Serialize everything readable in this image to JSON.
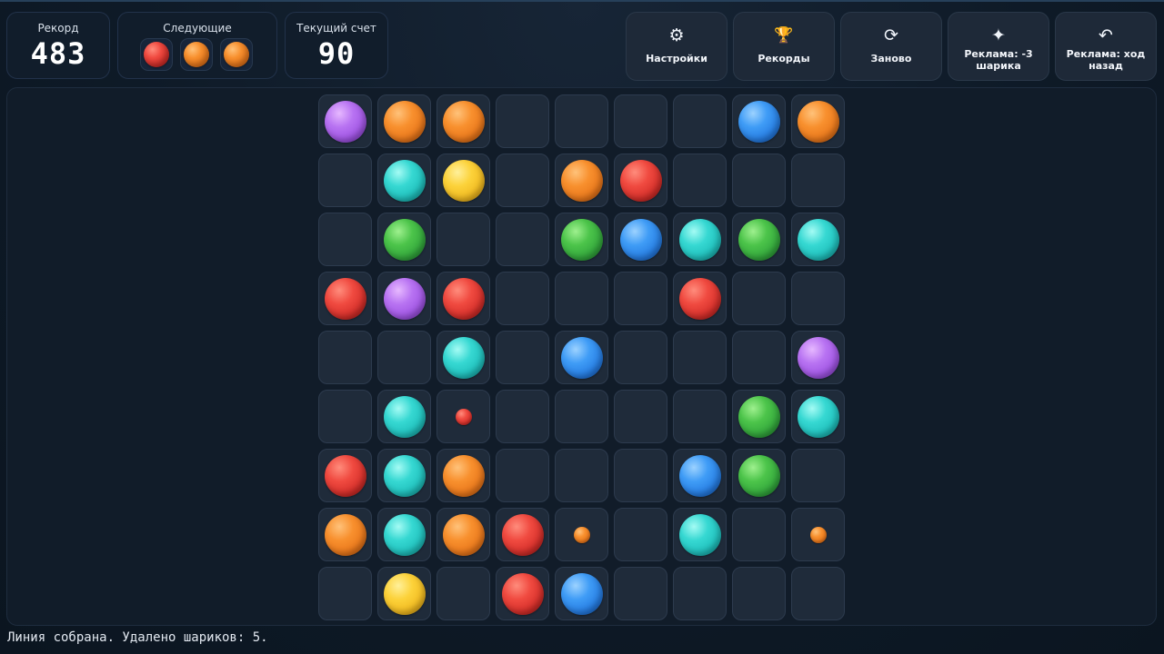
{
  "header": {
    "record": {
      "label": "Рекорд",
      "value": "483"
    },
    "next": {
      "label": "Следующие",
      "balls": [
        "red",
        "orange",
        "orange"
      ]
    },
    "score": {
      "label": "Текущий счет",
      "value": "90"
    }
  },
  "buttons": [
    {
      "id": "settings",
      "icon": "gear-icon",
      "glyph": "⚙",
      "label": "Настройки"
    },
    {
      "id": "records",
      "icon": "trophy-icon",
      "glyph": "🏆",
      "label": "Рекорды"
    },
    {
      "id": "restart",
      "icon": "restart-icon",
      "glyph": "⟳",
      "label": "Заново"
    },
    {
      "id": "ad-remove-balls",
      "icon": "sparkle-icon",
      "glyph": "✦",
      "label": "Реклама: -3 шарика"
    },
    {
      "id": "ad-undo",
      "icon": "undo-icon",
      "glyph": "↶",
      "label": "Реклама: ход назад"
    }
  ],
  "board": {
    "rows": [
      [
        "purple",
        "orange",
        "orange",
        "",
        "",
        "",
        "",
        "blue",
        "orange"
      ],
      [
        "",
        "cyan",
        "yellow",
        "",
        "orange",
        "red",
        "",
        "",
        ""
      ],
      [
        "",
        "green",
        "",
        "",
        "green",
        "blue",
        "cyan",
        "green",
        "cyan"
      ],
      [
        "red",
        "purple",
        "red",
        "",
        "",
        "",
        "red",
        "",
        ""
      ],
      [
        "",
        "",
        "cyan",
        "",
        "blue",
        "",
        "",
        "",
        "purple"
      ],
      [
        "",
        "cyan",
        "red-small",
        "",
        "",
        "",
        "",
        "green",
        "cyan"
      ],
      [
        "red",
        "cyan",
        "orange",
        "",
        "",
        "",
        "blue",
        "green",
        ""
      ],
      [
        "orange",
        "cyan",
        "orange",
        "red",
        "orange-small",
        "",
        "cyan",
        "",
        "orange-small"
      ],
      [
        "",
        "yellow",
        "",
        "red",
        "blue",
        "",
        "",
        "",
        ""
      ]
    ]
  },
  "status": "Линия собрана. Удалено шариков: 5."
}
